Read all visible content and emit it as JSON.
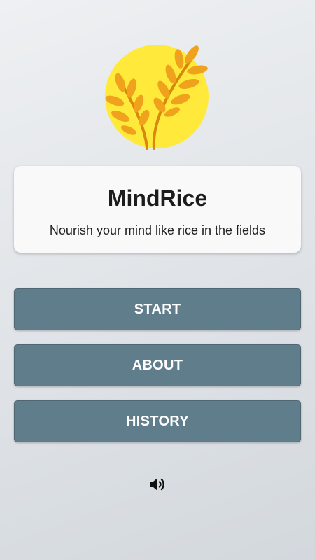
{
  "app": {
    "title": "MindRice",
    "subtitle": "Nourish your mind like rice in the fields",
    "logo_icon": "rice-plant-icon"
  },
  "menu": {
    "start_label": "START",
    "about_label": "ABOUT",
    "history_label": "HISTORY"
  },
  "sound": {
    "icon": "speaker-volume-icon"
  },
  "colors": {
    "sun": "#ffea3b",
    "grain": "#f0a21c",
    "grain_dark": "#d9870e",
    "button": "#607d8b",
    "card": "#f9f9f9"
  }
}
